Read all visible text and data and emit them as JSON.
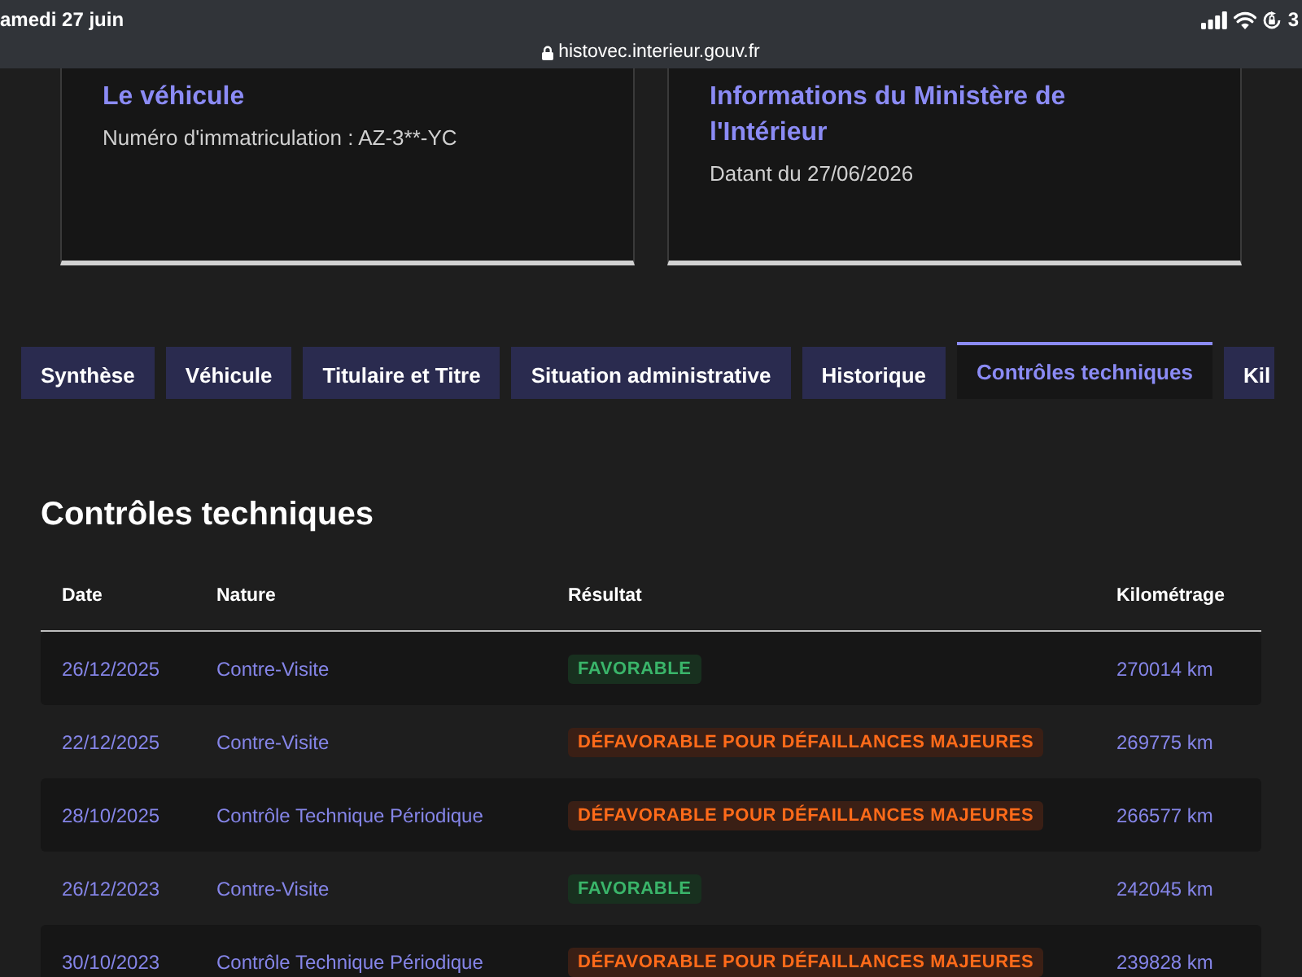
{
  "status_bar": {
    "date": "amedi 27 juin",
    "right_text": "3"
  },
  "address_bar": {
    "url": "histovec.interieur.gouv.fr"
  },
  "cards": [
    {
      "title": "Le véhicule",
      "text": "Numéro d'immatriculation : AZ-3**-YC"
    },
    {
      "title": "Informations du Ministère de l'Intérieur",
      "text": "Datant du 27/06/2026"
    }
  ],
  "tabs": [
    {
      "label": "Synthèse",
      "selected": false
    },
    {
      "label": "Véhicule",
      "selected": false
    },
    {
      "label": "Titulaire et Titre",
      "selected": false
    },
    {
      "label": "Situation administrative",
      "selected": false
    },
    {
      "label": "Historique",
      "selected": false
    },
    {
      "label": "Contrôles techniques",
      "selected": true
    },
    {
      "label": "Kil",
      "selected": false
    }
  ],
  "section": {
    "title": "Contrôles techniques",
    "table": {
      "columns": [
        "Date",
        "Nature",
        "Résultat",
        "Kilométrage"
      ],
      "rows": [
        {
          "date": "26/12/2025",
          "nature": "Contre-Visite",
          "result": {
            "label": "FAVORABLE",
            "kind": "favorable"
          },
          "mileage": "270014 km"
        },
        {
          "date": "22/12/2025",
          "nature": "Contre-Visite",
          "result": {
            "label": "DÉFAVORABLE POUR DÉFAILLANCES MAJEURES",
            "kind": "unfavorable"
          },
          "mileage": "269775 km"
        },
        {
          "date": "28/10/2025",
          "nature": "Contrôle Technique Périodique",
          "result": {
            "label": "DÉFAVORABLE POUR DÉFAILLANCES MAJEURES",
            "kind": "unfavorable"
          },
          "mileage": "266577 km"
        },
        {
          "date": "26/12/2023",
          "nature": "Contre-Visite",
          "result": {
            "label": "FAVORABLE",
            "kind": "favorable"
          },
          "mileage": "242045 km"
        },
        {
          "date": "30/10/2023",
          "nature": "Contrôle Technique Périodique",
          "result": {
            "label": "DÉFAVORABLE POUR DÉFAILLANCES MAJEURES",
            "kind": "unfavorable"
          },
          "mileage": "239828 km"
        }
      ]
    }
  }
}
